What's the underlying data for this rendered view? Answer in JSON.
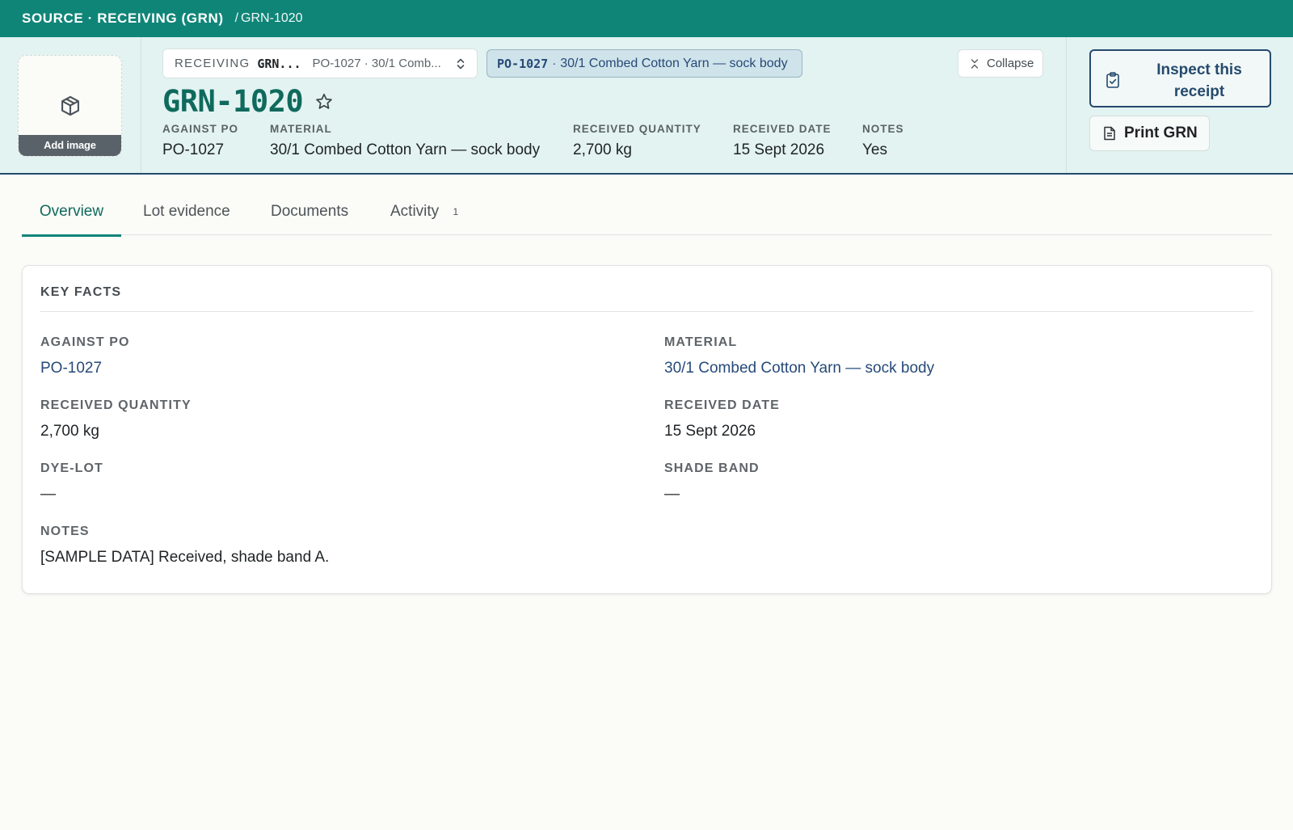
{
  "breadcrumb": {
    "root": "SOURCE · RECEIVING (GRN)",
    "separator": "/",
    "current": "GRN-1020"
  },
  "thumbnail": {
    "icon": "package-icon",
    "add_label": "Add image"
  },
  "switcher": {
    "type_label": "RECEIVING",
    "code": "GRN...",
    "description": "PO-1027 · 30/1 Comb...",
    "icon": "chevron-up-down-icon"
  },
  "po_chip": {
    "code": "PO-1027",
    "separator": "·",
    "description": "30/1 Combed Cotton Yarn — sock body"
  },
  "collapse_label": "Collapse",
  "title": "GRN-1020",
  "summary": [
    {
      "label": "AGAINST PO",
      "value": "PO-1027"
    },
    {
      "label": "MATERIAL",
      "value": "30/1 Combed Cotton Yarn — sock body"
    },
    {
      "label": "RECEIVED QUANTITY",
      "value": "2,700 kg"
    },
    {
      "label": "RECEIVED DATE",
      "value": "15 Sept 2026"
    },
    {
      "label": "NOTES",
      "value": "Yes"
    }
  ],
  "actions": {
    "inspect_label": "Inspect this receipt",
    "print_label": "Print GRN"
  },
  "tabs": [
    {
      "label": "Overview",
      "active": true
    },
    {
      "label": "Lot evidence"
    },
    {
      "label": "Documents"
    },
    {
      "label": "Activity",
      "count": "1"
    }
  ],
  "key_facts": {
    "title": "KEY FACTS",
    "facts": [
      {
        "label": "AGAINST PO",
        "value": "PO-1027",
        "link": true
      },
      {
        "label": "MATERIAL",
        "value": "30/1 Combed Cotton Yarn — sock body",
        "link": true
      },
      {
        "label": "RECEIVED QUANTITY",
        "value": "2,700 kg"
      },
      {
        "label": "RECEIVED DATE",
        "value": "15 Sept 2026"
      },
      {
        "label": "DYE-LOT",
        "value": "—"
      },
      {
        "label": "SHADE BAND",
        "value": "—"
      },
      {
        "label": "NOTES",
        "value": "[SAMPLE DATA] Received, shade band A."
      }
    ]
  },
  "colors": {
    "topbar": "#0f8578",
    "header_bg": "#e3f3f1",
    "accent_navy": "#254a6d",
    "title_green": "#0f6a5d",
    "link_blue": "#264a78"
  }
}
